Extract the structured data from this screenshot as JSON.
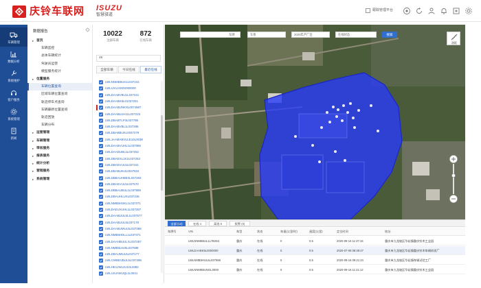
{
  "header": {
    "app_title": "庆铃车联网",
    "brand_name": "ISUZU",
    "brand_sub": "智慧驿道",
    "checkbox_label": "跟踪管理平台",
    "icons": [
      "help-icon",
      "refresh-icon",
      "user-icon",
      "bell-icon",
      "expand-icon",
      "gear-icon"
    ]
  },
  "nav": {
    "items": [
      {
        "label": "车辆管理",
        "icon": "truck-icon"
      },
      {
        "label": "数据分析",
        "icon": "chart-icon"
      },
      {
        "label": "系统维护",
        "icon": "wrench-icon"
      },
      {
        "label": "客户服务",
        "icon": "headset-icon"
      },
      {
        "label": "系统管理",
        "icon": "settings-icon"
      },
      {
        "label": "新闻",
        "icon": "doc-icon"
      }
    ]
  },
  "menu": {
    "title": "数据报告",
    "items": [
      {
        "label": "首页",
        "type": "group"
      },
      {
        "label": "车辆监控",
        "type": "item"
      },
      {
        "label": "总体车辆统计",
        "type": "item"
      },
      {
        "label": "驾驶员运营",
        "type": "item"
      },
      {
        "label": "模型服务统计",
        "type": "item"
      },
      {
        "label": "位置服务",
        "type": "group"
      },
      {
        "label": "车辆位置查询",
        "type": "active"
      },
      {
        "label": "区域车辆位置查询",
        "type": "item"
      },
      {
        "label": "轨迹停车点查询",
        "type": "item"
      },
      {
        "label": "车辆最新位置查询",
        "type": "item"
      },
      {
        "label": "轨迹回放",
        "type": "item"
      },
      {
        "label": "车辆分布",
        "type": "item"
      },
      {
        "label": "运营管理",
        "type": "group"
      },
      {
        "label": "车辆管理",
        "type": "group"
      },
      {
        "label": "审核服务",
        "type": "group"
      },
      {
        "label": "报表服务",
        "type": "group"
      },
      {
        "label": "统计分析",
        "type": "group"
      },
      {
        "label": "营销服务",
        "type": "group"
      },
      {
        "label": "系统管理",
        "type": "group"
      }
    ]
  },
  "panel": {
    "stats": [
      {
        "value": "10022",
        "label": "注册车辆"
      },
      {
        "value": "872",
        "label": "在线车辆"
      }
    ],
    "search_value": "46",
    "tabs": [
      "全部车辆",
      "今日在线",
      "最近在线"
    ],
    "vehicles": [
      "LWLNNMB5US1L037244",
      "LWLUX1J4X0S000000",
      "LWLDAABVBU1L037221",
      "LWLDAABK5L01037251",
      "LWLDAABUNKXL0074587",
      "LWLDAABLUH11L037223",
      "LWLDBABTLF0L037788",
      "LWLDAABVBL1L037286",
      "LWLDBABBUKL0037279",
      "LWLJAAMABVULE10L0038",
      "LWLDAABVUHL1L037086",
      "LWLDAADUBL1L037252",
      "LWLDBAEXL1K1L037253",
      "LWLDBAEVUL5L037161",
      "LWLDBABUKUL0037822",
      "LWLDBBAUHB5XL037283",
      "LWLDBAEVUL5L037570",
      "LWLDBBAUBUL1L037589",
      "LWLDBAUHLUXL037246",
      "LWLNMB5HSKL1L037371",
      "LWLDAEUXUHL1L037287",
      "LWLDAABUUL5L1L037577",
      "LWLDAABUUL5L037178",
      "LWLDAABUMUL5L037388",
      "LWLNMB5HDLL1L037371",
      "LWLDAAHBUULXL037287",
      "LWLNMB5L6U5L037588",
      "LWLDBAUMUL5L037177",
      "LWLCWBEVBUL5L037289",
      "LWLHE1JWL3U10L0382",
      "LWLUSJAMUQL1L0041"
    ]
  },
  "map": {
    "filters": [
      "车牌",
      "车系",
      "2020年产厂区",
      "在线状态"
    ],
    "search_button": "搜索",
    "tool_label": "测距",
    "colors": {
      "fence": "#2a3cf5",
      "fence_border": "#1a26c8"
    }
  },
  "bottom": {
    "tabs": [
      "全部 (12)",
      "在线 4",
      "离线 8",
      "报警 (0)"
    ],
    "columns": [
      "车牌号",
      "VIN",
      "车型",
      "状态",
      "车速(公里/时)",
      "速度(公里)",
      "定位时间",
      "地址"
    ],
    "rows": [
      [
        "",
        "LWLNNMB5UL1L7B254",
        "重庆",
        "在线",
        "0",
        "0.5",
        "2020-09-16 11:37:16",
        "重庆市九龙坡区华岩镇重庆铃木工业园"
      ],
      [
        "",
        "LWLDAABK5L0000000",
        "重庆",
        "在线",
        "0",
        "0.5",
        "2020-07-08 08:39:27",
        "重庆市九龙坡区华岩镇重庆铃木车辆研发厂"
      ],
      [
        "",
        "LWLNMB5HUL5L037598",
        "重庆",
        "在线",
        "0",
        "0.5",
        "2020-09-16 09:41:24",
        "重庆市九龙坡区华岩镇车辆试验工厂"
      ],
      [
        "",
        "LWLNNMB5UNGL0000",
        "重庆",
        "在线",
        "0",
        "0.5",
        "2020-09-16 11:21:12",
        "重庆市九龙坡区华岩镇重庆铃木工业园"
      ]
    ]
  }
}
